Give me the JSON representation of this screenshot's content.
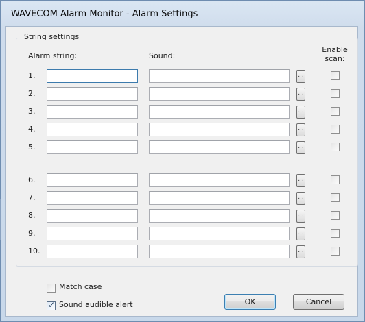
{
  "window": {
    "title": "WAVECOM Alarm Monitor - Alarm Settings"
  },
  "group": {
    "title": "String settings",
    "col_alarm": "Alarm string:",
    "col_sound": "Sound:",
    "col_enable_line1": "Enable",
    "col_enable_line2": "scan:"
  },
  "rows": [
    {
      "num": "1.",
      "alarm": "",
      "sound": "",
      "browse": "...",
      "enable": false
    },
    {
      "num": "2.",
      "alarm": "",
      "sound": "",
      "browse": "...",
      "enable": false
    },
    {
      "num": "3.",
      "alarm": "",
      "sound": "",
      "browse": "...",
      "enable": false
    },
    {
      "num": "4.",
      "alarm": "",
      "sound": "",
      "browse": "...",
      "enable": false
    },
    {
      "num": "5.",
      "alarm": "",
      "sound": "",
      "browse": "...",
      "enable": false
    },
    {
      "num": "6.",
      "alarm": "",
      "sound": "",
      "browse": "...",
      "enable": false
    },
    {
      "num": "7.",
      "alarm": "",
      "sound": "",
      "browse": "...",
      "enable": false
    },
    {
      "num": "8.",
      "alarm": "",
      "sound": "",
      "browse": "...",
      "enable": false
    },
    {
      "num": "9.",
      "alarm": "",
      "sound": "",
      "browse": "...",
      "enable": false
    },
    {
      "num": "10.",
      "alarm": "",
      "sound": "",
      "browse": "...",
      "enable": false
    }
  ],
  "options": {
    "match_case": {
      "label": "Match case",
      "checked": false
    },
    "sound_alert": {
      "label": "Sound audible alert",
      "checked": true
    }
  },
  "buttons": {
    "ok": "OK",
    "cancel": "Cancel"
  },
  "colors": {
    "focus_border": "#3d7bad",
    "title_gradient": "#cfdcec"
  }
}
